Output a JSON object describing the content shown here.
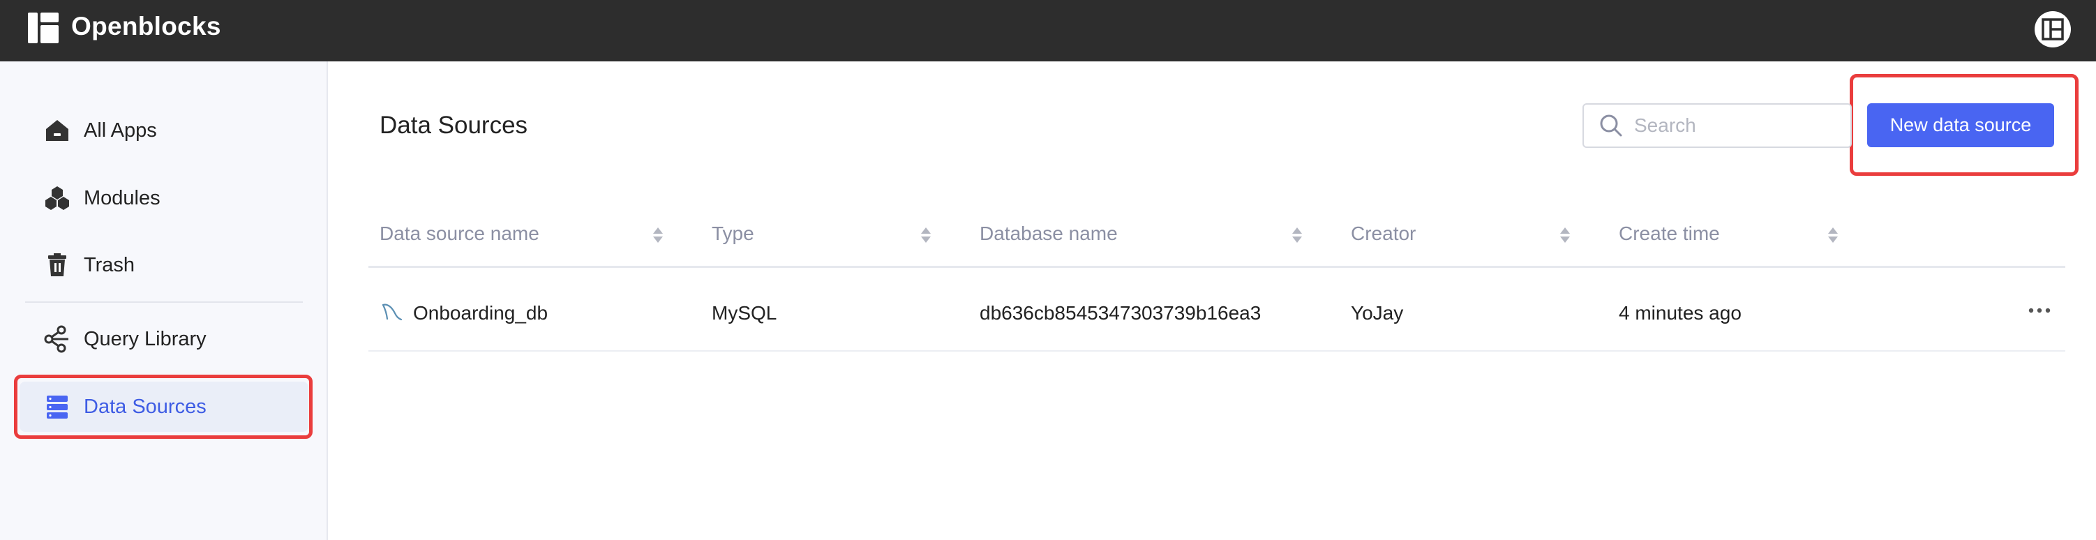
{
  "app": {
    "name": "Openblocks",
    "logo_icon": "openblocks-logo-icon",
    "profile_icon": "user-profile-icon"
  },
  "sidebar": {
    "items": [
      {
        "label": "All Apps",
        "icon": "home-icon",
        "active": false
      },
      {
        "label": "Modules",
        "icon": "modules-icon",
        "active": false
      },
      {
        "label": "Trash",
        "icon": "trash-icon",
        "active": false
      },
      {
        "label": "Query Library",
        "icon": "query-library-icon",
        "active": false
      },
      {
        "label": "Data Sources",
        "icon": "data-sources-icon",
        "active": true
      }
    ]
  },
  "main": {
    "title": "Data Sources",
    "search": {
      "placeholder": "Search",
      "value": ""
    },
    "new_button_label": "New data source"
  },
  "table": {
    "columns": [
      "Data source name",
      "Type",
      "Database name",
      "Creator",
      "Create time"
    ],
    "rows": [
      {
        "name": "Onboarding_db",
        "type": "MySQL",
        "database": "db636cb8545347303739b16ea3",
        "creator": "YoJay",
        "created": "4 minutes ago"
      }
    ]
  },
  "colors": {
    "accent": "#4965f2",
    "topbar": "#2d2d2d",
    "sidebar_bg": "#f7f8fc",
    "active_item_bg": "#eaeef8",
    "highlight_box": "#ea3d3d"
  }
}
